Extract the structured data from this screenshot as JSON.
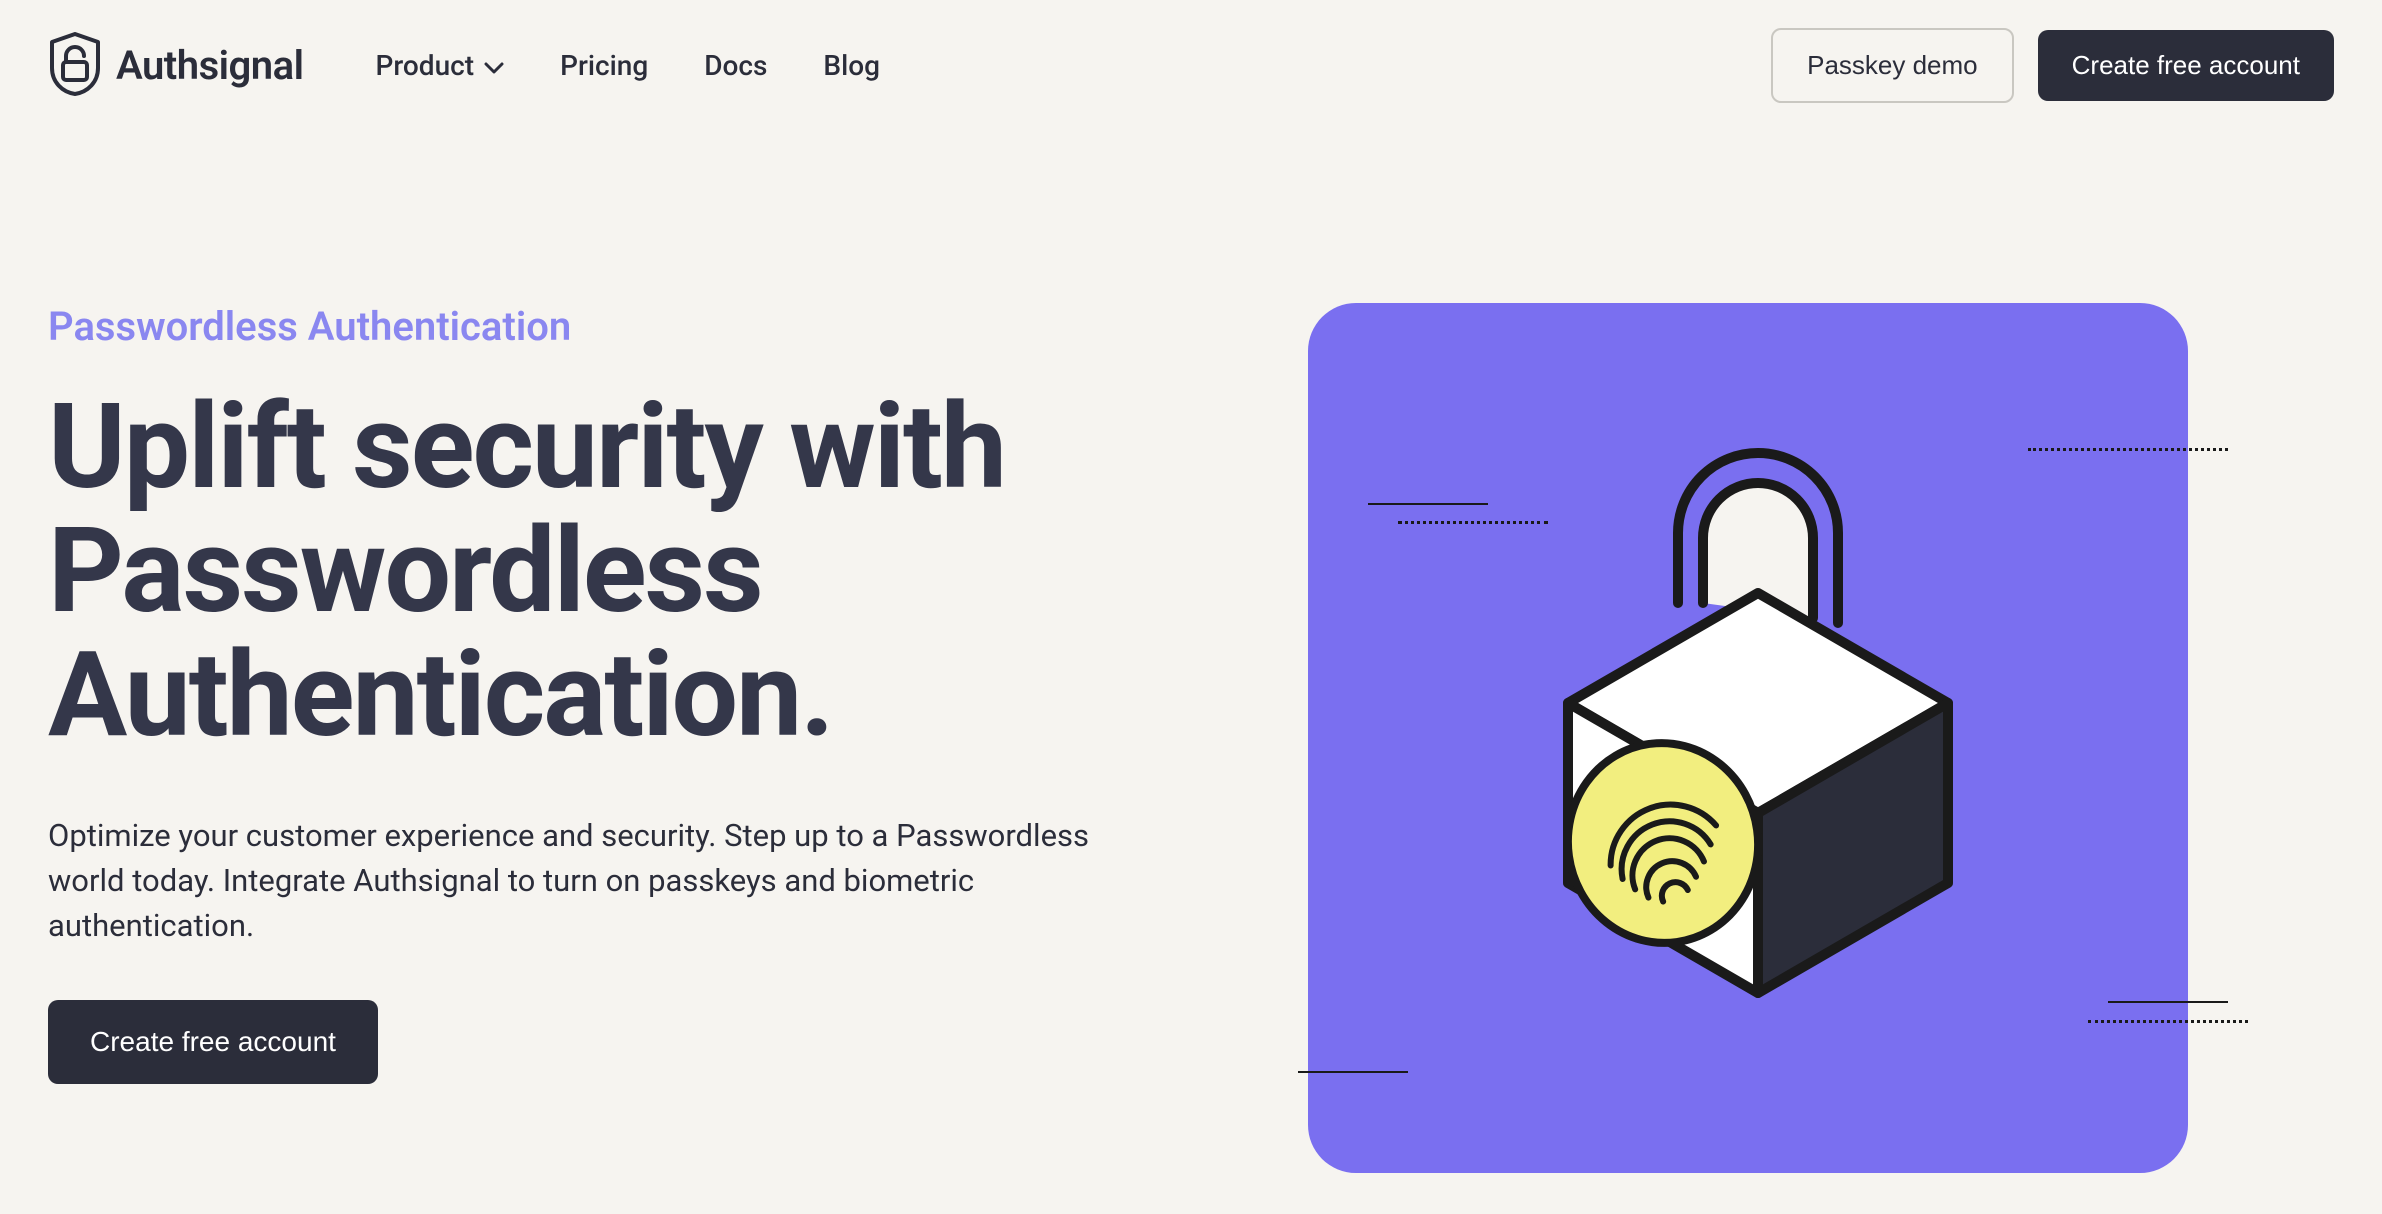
{
  "brand": {
    "name": "Authsignal"
  },
  "nav": {
    "items": [
      {
        "label": "Product",
        "has_dropdown": true
      },
      {
        "label": "Pricing",
        "has_dropdown": false
      },
      {
        "label": "Docs",
        "has_dropdown": false
      },
      {
        "label": "Blog",
        "has_dropdown": false
      }
    ],
    "passkey_demo": "Passkey demo",
    "create_account": "Create free account"
  },
  "hero": {
    "eyebrow": "Passwordless Authentication",
    "headline": "Uplift security with Passwordless Authentication.",
    "subhead": "Optimize your customer experience and security. Step up to a Passwordless world today. Integrate Authsignal to turn on passkeys and biometric authentication.",
    "cta": "Create free account"
  },
  "colors": {
    "accent_purple": "#7a6ff0",
    "accent_periwinkle": "#8a87f0",
    "dark": "#2b2d3a",
    "bg": "#f6f4f0"
  }
}
